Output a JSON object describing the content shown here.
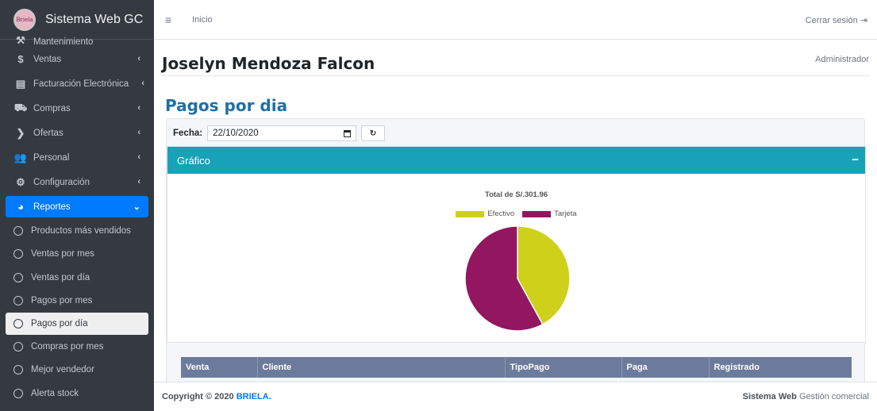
{
  "brand": {
    "logo_text": "Briela",
    "title": "Sistema Web GC"
  },
  "sidebar": {
    "partial_item": "Mantenimiento",
    "items": [
      {
        "label": "Ventas",
        "icon": "dollar-icon"
      },
      {
        "label": "Facturación Electrónica",
        "icon": "invoice-icon"
      },
      {
        "label": "Compras",
        "icon": "cart-icon"
      },
      {
        "label": "Ofertas",
        "icon": "tags-icon"
      },
      {
        "label": "Personal",
        "icon": "users-icon"
      },
      {
        "label": "Configuración",
        "icon": "cog-icon"
      }
    ],
    "active_item": {
      "label": "Reportes",
      "icon": "pie-chart-icon"
    },
    "subitems": [
      "Productos más vendidos",
      "Ventas por mes",
      "Ventas por día",
      "Pagos por mes",
      "Pagos por día",
      "Compras por mes",
      "Mejor vendedor",
      "Alerta stock"
    ]
  },
  "topbar": {
    "home": "Inicio",
    "logout": "Cerrar sesión"
  },
  "user": {
    "name": "Joselyn Mendoza Falcon",
    "role": "Administrador"
  },
  "page": {
    "title": "Pagos por dia"
  },
  "filter": {
    "label": "Fecha:",
    "date_value": "22/10/2020"
  },
  "card": {
    "header": "Gráfico"
  },
  "chart_data": {
    "type": "pie",
    "title": "Total de S/.301.96",
    "legend_position": "top",
    "slices": [
      {
        "label": "Efectivo",
        "value": 42,
        "color": "#cfd01a"
      },
      {
        "label": "Tarjeta",
        "value": 58,
        "color": "#921660"
      }
    ]
  },
  "table": {
    "headers": [
      "Venta",
      "Cliente",
      "TipoPago",
      "Paga",
      "Registrado"
    ]
  },
  "footer": {
    "copyright": "Copyright © 2020",
    "brand": "BRIELA.",
    "right_bold": "Sistema Web",
    "right_rest": "Gestión comercial"
  },
  "colors": {
    "sidebar": "#343a40",
    "accent": "#007bff",
    "card_header": "#17a2b8",
    "table_header": "#6c7b9b"
  }
}
